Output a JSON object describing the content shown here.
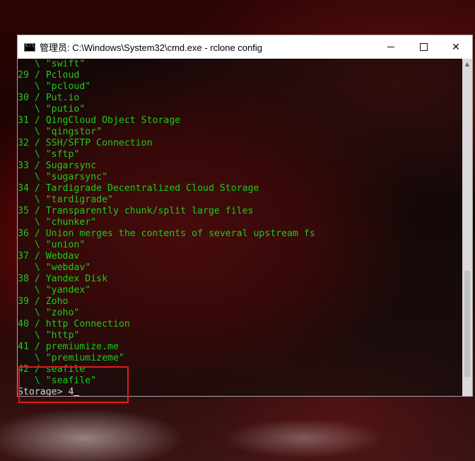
{
  "window": {
    "title": "管理员: C:\\Windows\\System32\\cmd.exe - rclone  config",
    "icon": "cmd-icon",
    "controls": {
      "minimize": "minimize",
      "maximize": "maximize",
      "close": "✕"
    }
  },
  "terminal": {
    "lines": [
      "   \\ \"swift\"",
      "29 / Pcloud",
      "   \\ \"pcloud\"",
      "30 / Put.io",
      "   \\ \"putio\"",
      "31 / QingCloud Object Storage",
      "   \\ \"qingstor\"",
      "32 / SSH/SFTP Connection",
      "   \\ \"sftp\"",
      "33 / Sugarsync",
      "   \\ \"sugarsync\"",
      "34 / Tardigrade Decentralized Cloud Storage",
      "   \\ \"tardigrade\"",
      "35 / Transparently chunk/split large files",
      "   \\ \"chunker\"",
      "36 / Union merges the contents of several upstream fs",
      "   \\ \"union\"",
      "37 / Webdav",
      "   \\ \"webdav\"",
      "38 / Yandex Disk",
      "   \\ \"yandex\"",
      "39 / Zoho",
      "   \\ \"zoho\"",
      "40 / http Connection",
      "   \\ \"http\"",
      "41 / premiumize.me",
      "   \\ \"premiumizeme\"",
      "42 / seafile",
      "   \\ \"seafile\""
    ],
    "prompt": "Storage> 4"
  },
  "colors": {
    "terminal_text": "#1dcb1d",
    "prompt_text": "#d8d8d8",
    "highlight": "#e01b1b"
  }
}
